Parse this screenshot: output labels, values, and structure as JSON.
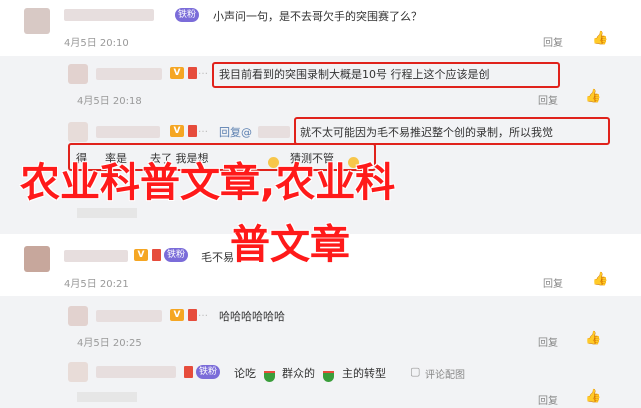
{
  "colors": {
    "accent_red": "#e0221b",
    "reply_bg": "#f2f3f5",
    "meta_gray": "#999999"
  },
  "labels": {
    "reply": "回复",
    "like_icon": "thumbs-up-icon"
  },
  "c1": {
    "fan_badge": "铁粉",
    "text": "小声问一句，是不去哥欠手的突围赛了么？",
    "time": "4月5日 20:10"
  },
  "r1": {
    "text": "我目前看到的突围录制大概是10号 行程上这个应该是创",
    "time": "4月5日 20:18"
  },
  "r2": {
    "reply_prefix": "回复@",
    "text": "就不太可能因为毛不易推迟整个创的录制，所以我觉",
    "line2_start": "得",
    "line2_mid": "率是",
    "line2_end": "去了 我是想",
    "line2_tail": "猜测不管"
  },
  "c2": {
    "fan_badge": "铁粉",
    "text": "毛不易",
    "time": "4月5日 20:21"
  },
  "c3": {
    "text": "哈哈哈哈哈哈",
    "time": "4月5日 20:25"
  },
  "c4": {
    "fan_badge": "铁粉",
    "text_a": "论吃",
    "text_b": "群众的",
    "text_c": "主的转型",
    "comment_pic": "评论配图"
  },
  "overlay": {
    "line1": "农业科普文章,农业科",
    "line2": "普文章"
  }
}
